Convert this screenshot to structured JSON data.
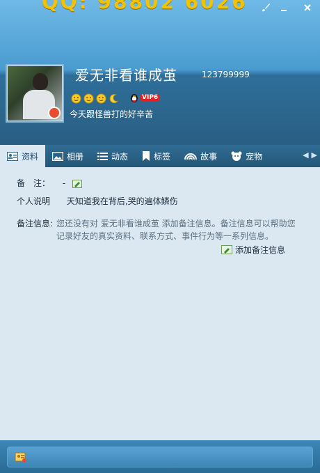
{
  "header": {
    "deco_text": "QQ: 98802 6026",
    "nickname": "爱无非看谁成茧",
    "qq_number": "123799999",
    "vip_label": "VIP6",
    "signature": "今天跟怪兽打的好辛苦"
  },
  "tabs": [
    {
      "label": "资料",
      "icon": "profile-card-icon",
      "active": true
    },
    {
      "label": "相册",
      "icon": "photo-album-icon",
      "active": false
    },
    {
      "label": "动态",
      "icon": "feed-list-icon",
      "active": false
    },
    {
      "label": "标签",
      "icon": "bookmark-tag-icon",
      "active": false
    },
    {
      "label": "故事",
      "icon": "story-rainbow-icon",
      "active": false
    },
    {
      "label": "宠物",
      "icon": "pet-icon",
      "active": false
    }
  ],
  "profile": {
    "remark_label": "备　注：",
    "remark_value": "-",
    "desc_label": "个人说明",
    "desc_value": "天知道我在背后,哭的遍体鳞伤",
    "note_label": "备注信息:",
    "note_text": "您还没有对 爱无非看谁成茧 添加备注信息。备注信息可以帮助您记录好友的真实资料、联系方式、事件行为等一系列信息。",
    "add_note_label": "添加备注信息"
  },
  "colors": {
    "header_top": "#6fb9e6",
    "header_bottom": "#2a5e83",
    "content_bg": "#dbe8f1",
    "vip_red": "#e02222"
  }
}
